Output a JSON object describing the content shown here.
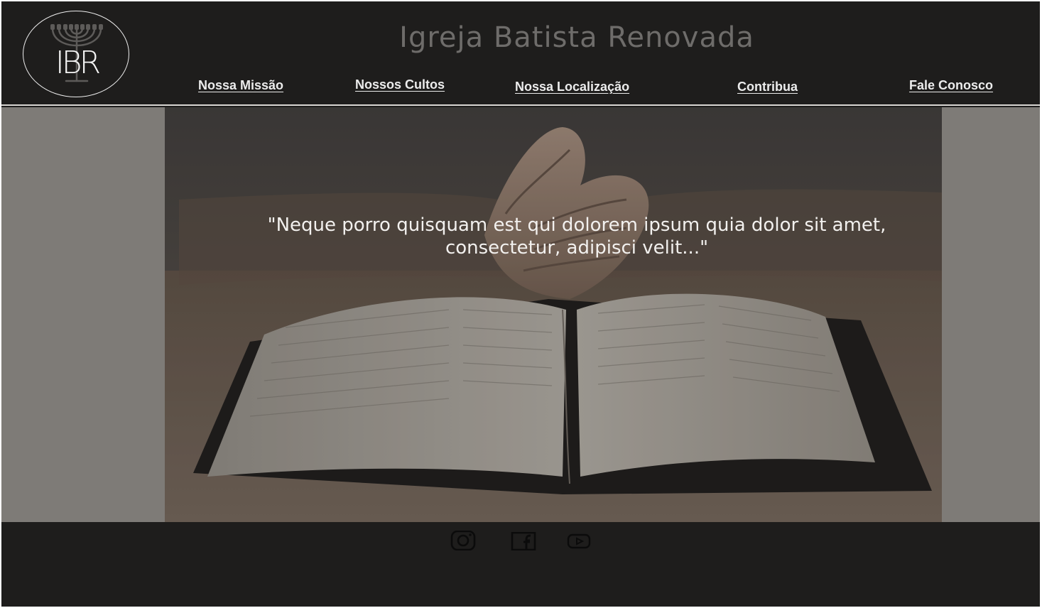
{
  "header": {
    "logo_text": "IBR",
    "title": "Igreja Batista Renovada",
    "nav": [
      {
        "label": "Nossa Missão"
      },
      {
        "label": "Nossos Cultos"
      },
      {
        "label": "Nossa Localização"
      },
      {
        "label": "Contribua"
      },
      {
        "label": "Fale Conosco"
      }
    ]
  },
  "hero": {
    "quote": "\"Neque porro quisquam est qui dolorem ipsum quia dolor sit amet, consectetur, adipisci velit...\""
  },
  "footer": {
    "social": [
      {
        "icon": "instagram-icon"
      },
      {
        "icon": "facebook-icon"
      },
      {
        "icon": "youtube-icon"
      }
    ]
  },
  "colors": {
    "header_bg": "#1e1d1c",
    "hero_side_bg": "#7e7b77",
    "title_color": "#6e6c6a",
    "nav_text": "#ececec"
  }
}
